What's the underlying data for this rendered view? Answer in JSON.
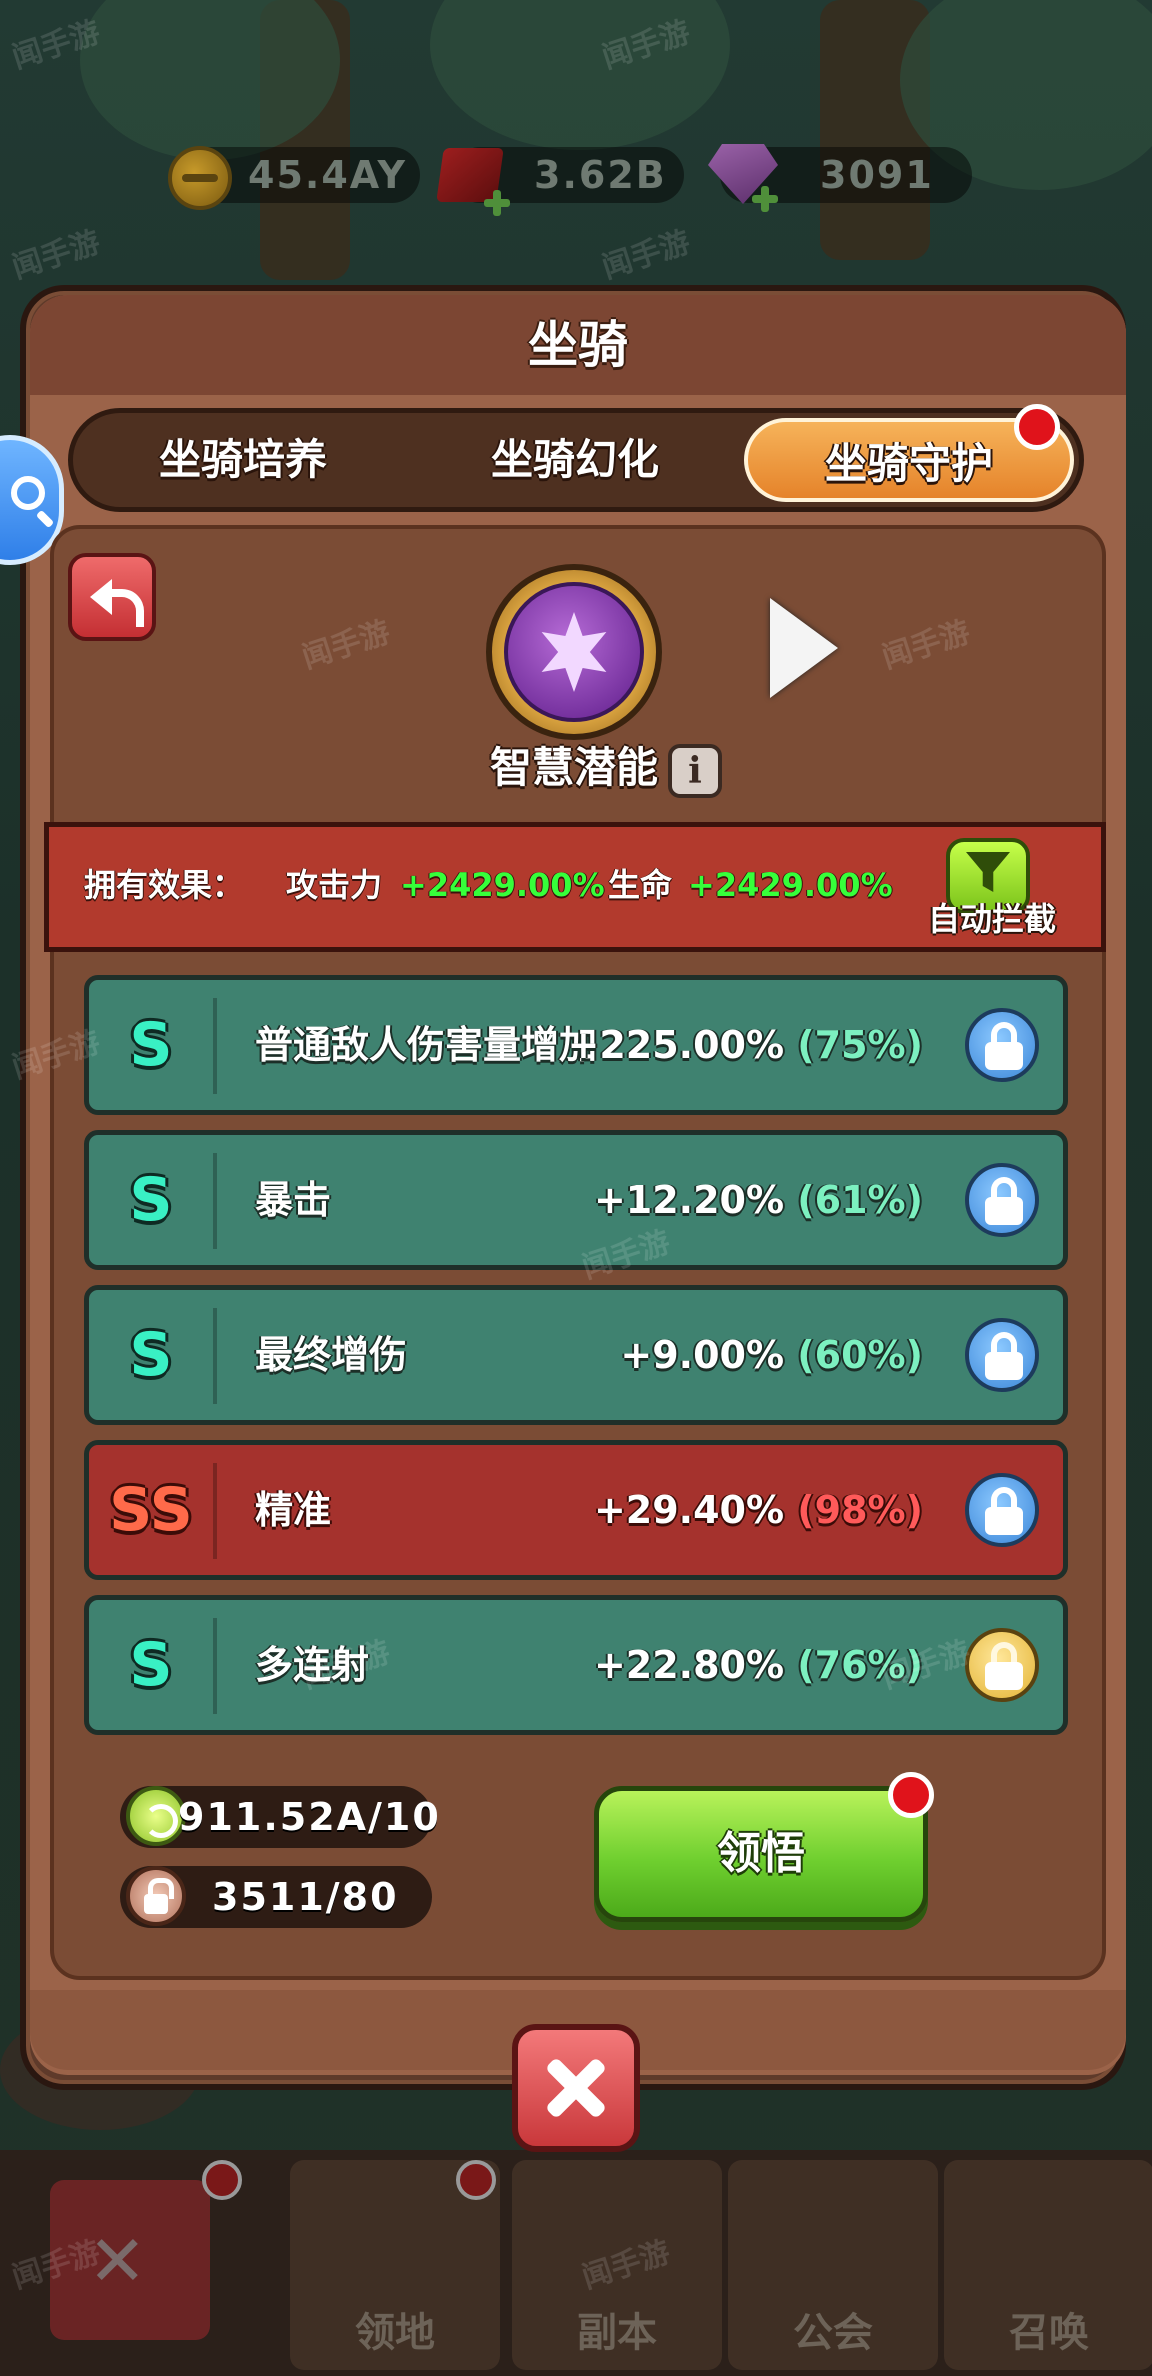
{
  "window": {
    "title": "坐骑"
  },
  "currencies": [
    {
      "icon": "gold-coin-icon",
      "value": "45.4AY"
    },
    {
      "icon": "ruby-icon",
      "value": "3.62B"
    },
    {
      "icon": "diamond-icon",
      "value": "3091"
    }
  ],
  "tabs": [
    {
      "label": "坐骑培养",
      "active": false
    },
    {
      "label": "坐骑幻化",
      "active": false
    },
    {
      "label": "坐骑守护",
      "active": true,
      "badge": true
    }
  ],
  "guardian": {
    "name": "智慧潜能",
    "info_icon": "i"
  },
  "owned_effect": {
    "label": "拥有效果：",
    "attack_label": "攻击力",
    "attack_value": "+2429.00%",
    "hp_label": "生命",
    "hp_value": "+2429.00%"
  },
  "auto_intercept": {
    "label": "自动拦截"
  },
  "stats": [
    {
      "grade": "S",
      "name": "普通敌人伤害量增加",
      "value": "+225.00%",
      "percent": "(75%)",
      "color": "green",
      "lock": "blue"
    },
    {
      "grade": "S",
      "name": "暴击",
      "value": "+12.20%",
      "percent": "(61%)",
      "color": "green",
      "lock": "blue"
    },
    {
      "grade": "S",
      "name": "最终增伤",
      "value": "+9.00%",
      "percent": "(60%)",
      "color": "green",
      "lock": "blue"
    },
    {
      "grade": "SS",
      "name": "精准",
      "value": "+29.40%",
      "percent": "(98%)",
      "color": "red",
      "lock": "blue"
    },
    {
      "grade": "S",
      "name": "多连射",
      "value": "+22.80%",
      "percent": "(76%)",
      "color": "green",
      "lock": "gold"
    }
  ],
  "resources": {
    "potential_stone": "911.52A/10",
    "lock_stone": "3511/80"
  },
  "comprehend_button": {
    "label": "领悟"
  },
  "bottom_nav": [
    {
      "label": ""
    },
    {
      "label": "领地"
    },
    {
      "label": "副本"
    },
    {
      "label": "公会"
    },
    {
      "label": "召唤"
    }
  ],
  "watermark": "闻手游",
  "colors": {
    "modal": "#9b6349",
    "row_green": "#3f8270",
    "row_red": "#a5322d",
    "accent_orange": "#e5832a",
    "effect_green": "#36ff3a",
    "button_green": "#6fcf2f"
  }
}
